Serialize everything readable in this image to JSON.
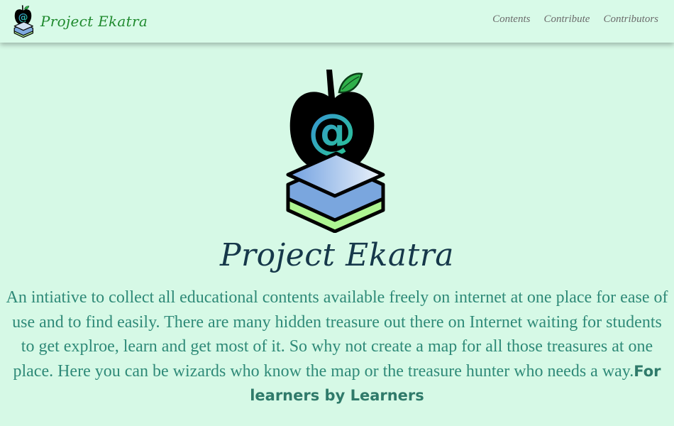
{
  "navbar": {
    "brand_name": "Project Ekatra",
    "links": [
      {
        "label": "Contents"
      },
      {
        "label": "Contribute"
      },
      {
        "label": "Contributors"
      }
    ]
  },
  "hero": {
    "title": "Project Ekatra",
    "description": "An intiative to collect all educational contents available freely on internet at one place for ease of use and to find easily. There are many hidden treasure out there on Internet waiting for students to get explroe, learn and get most of it. So why not create a map for all those treasures at one place. Here you can be wizards who know the map or the treasure hunter who needs a way.",
    "tagline": "For learners by Learners"
  },
  "colors": {
    "background": "#d6f9e6",
    "brand_green": "#1f8a2e",
    "title_navy": "#16384a",
    "text_teal": "#2f8a78",
    "leaf_green": "#2fb04a"
  },
  "icons": {
    "brand": "apple-books-at-logo",
    "hero": "apple-books-at-logo"
  }
}
